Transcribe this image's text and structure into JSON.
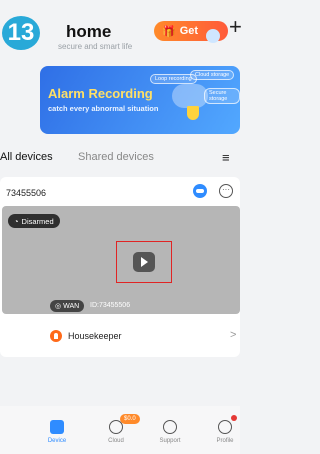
{
  "header": {
    "step_number": "13",
    "title": "home",
    "subtitle": "secure and smart life",
    "get_button_label": "Get",
    "add_symbol": "+"
  },
  "banner": {
    "title": "Alarm Recording",
    "subtitle": "catch every abnormal situation",
    "pills": [
      "Loop recording",
      "Cloud storage",
      "Secure storage"
    ]
  },
  "tabs": {
    "all_devices": "All devices",
    "shared_devices": "Shared devices"
  },
  "device_card": {
    "device_id": "73455506",
    "status": "Disarmed",
    "network": "WAN",
    "id_label": "ID:73455506",
    "feature_label": "Housekeeper"
  },
  "bottom_nav": {
    "items": [
      {
        "label": "Device",
        "icon": "device-icon"
      },
      {
        "label": "Cloud",
        "icon": "cloud-icon",
        "badge": "$0.0"
      },
      {
        "label": "Support",
        "icon": "support-icon"
      },
      {
        "label": "Profile",
        "icon": "profile-icon"
      }
    ]
  },
  "colors": {
    "accent": "#2f8cff",
    "get_gradient": "#ff6a3a",
    "highlight_frame": "#e02424"
  }
}
